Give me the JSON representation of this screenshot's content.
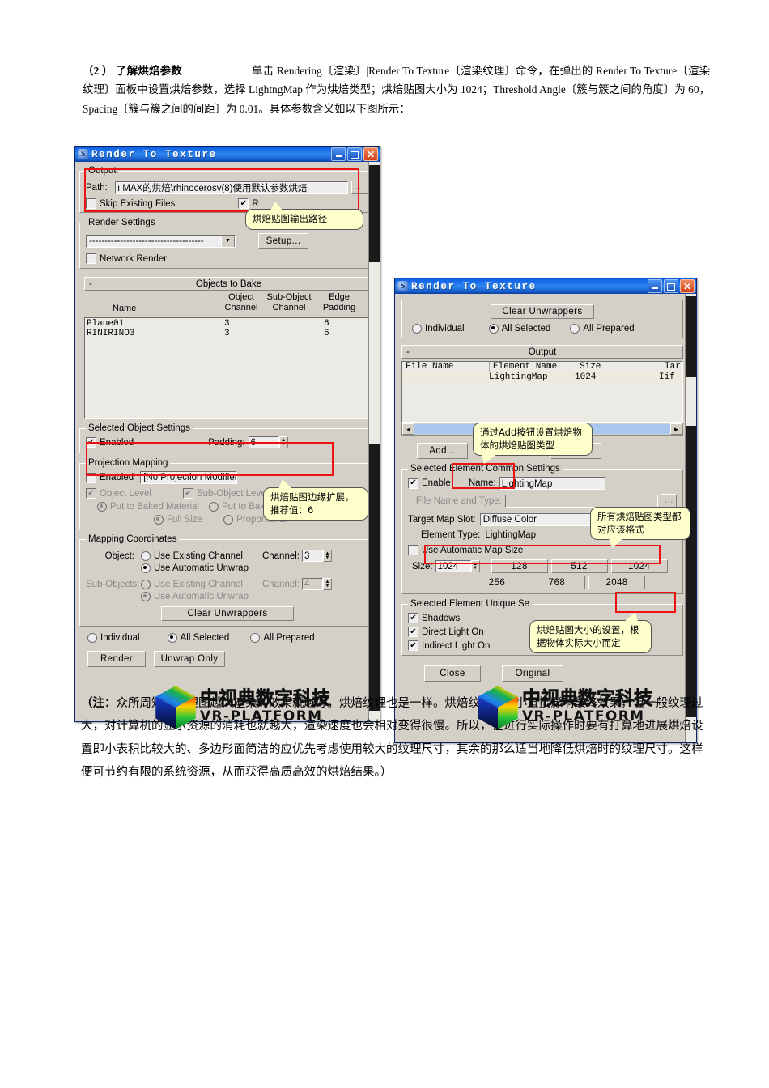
{
  "document": {
    "intro_label": "（2 ）",
    "intro_heading": "了解烘焙参数",
    "intro_body": "单击 Rendering〔渲染〕|Render To Texture〔渲染纹理〕命令，在弹出的 Render To Texture〔渲染纹理〕面板中设置烘焙参数，选择 LightngMap 作为烘焙类型；烘焙贴图大小为 1024；Threshold Angle〔簇与簇之间的角度〕为 60，Spacing〔簇与簇之间的间距〕为 0.01。具体参数含义如以下图所示：",
    "note_prefix": "（注：",
    "note_body": "众所周知，纹理图越大渲染的效果就越好，烘焙纹理也是一样。烘焙纹理的大小直接影响最终效果，但一般纹理过大，对计算机的显示资源的消耗也就越大，渲染速度也会相对变得很慢。所以，在进行实际操作时要有打算地进展烘焙设置即小表积比较大的、多边形面简洁的应优先考虑使用较大的纹理尺寸，其余的那么适当地降低烘焙时的纹理尺寸。这样便可节约有限的系统资源，从而获得高质高效的烘焙结果。）"
  },
  "window1": {
    "title": "Render To Texture",
    "icon": "max-logo-icon",
    "buttons": {
      "minimize": "–",
      "maximize": "□",
      "close": "✕"
    },
    "output": {
      "group_title": "Output",
      "path_label": "Path:",
      "path_value": "ı MAX的烘焙\\rhinocerosv(8)使用默认参数烘焙",
      "browse_label": "...",
      "skip_existing_label": "Skip Existing Files",
      "skip_existing_checked": false,
      "rendered_label": "R",
      "rendered_checked": true
    },
    "render_settings": {
      "group_title": "Render Settings",
      "preset_value": "-------------------------------------",
      "setup_label": "Setup...",
      "network_render_label": "Network Render",
      "network_render_checked": false
    },
    "objects_to_bake": {
      "rollout_title": "Objects to Bake",
      "rollout_minus": "-",
      "columns": [
        "Name",
        "Object Channel",
        "Sub-Object Channel",
        "Edge Padding"
      ],
      "rows": [
        {
          "name": "Plane01",
          "object_channel": "3",
          "sub_object_channel": "",
          "edge_padding": "6"
        },
        {
          "name": "RINIRINO3",
          "object_channel": "3",
          "sub_object_channel": "",
          "edge_padding": "6"
        }
      ]
    },
    "selected_object_settings": {
      "group_title": "Selected Object Settings",
      "enabled_label": "Enabled",
      "enabled_checked": true,
      "padding_label": "Padding:",
      "padding_value": "6"
    },
    "projection_mapping": {
      "group_title": "Projection Mapping",
      "enabled_label": "Enabled",
      "enabled_checked": false,
      "modifier_value": "[No Projection Modifier]",
      "object_level_label": "Object Level",
      "object_level_checked": true,
      "sub_object_levels_label": "Sub-Object Levels",
      "sub_object_levels_checked": true,
      "put_to_baked_material_1": "Put to Baked Material",
      "put_to_baked_material_2": "Put to Baked Material",
      "full_size_label": "Full Size",
      "proportional_label": "Proportional"
    },
    "mapping_coordinates": {
      "group_title": "Mapping Coordinates",
      "object_label": "Object:",
      "object_use_existing": "Use Existing Channel",
      "object_use_automatic": "Use Automatic Unwrap",
      "object_selected": "Use Automatic Unwrap",
      "object_channel_label": "Channel:",
      "object_channel_value": "3",
      "sub_objects_label": "Sub-Objects:",
      "sub_use_existing": "Use Existing Channel",
      "sub_use_automatic": "Use Automatic Unwrap",
      "sub_channel_label": "Channel:",
      "sub_channel_value": "4",
      "clear_unwrappers_label": "Clear Unwrappers"
    },
    "bake_scope": {
      "individual_label": "Individual",
      "all_selected_label": "All Selected",
      "all_prepared_label": "All Prepared",
      "selected": "All Selected"
    },
    "footer": {
      "render_label": "Render",
      "unwrap_only_label": "Unwrap Only"
    }
  },
  "window2": {
    "title": "Render To Texture",
    "icon": "max-logo-icon",
    "buttons": {
      "minimize": "–",
      "maximize": "□",
      "close": "✕"
    },
    "clear_unwrappers_label": "Clear Unwrappers",
    "bake_scope": {
      "individual_label": "Individual",
      "all_selected_label": "All Selected",
      "all_prepared_label": "All Prepared",
      "selected": "All Selected"
    },
    "output": {
      "rollout_title": "Output",
      "rollout_minus": "-",
      "columns": [
        "File Name",
        "Element Name",
        "Size",
        "Tar"
      ],
      "rows": [
        {
          "file_name": "",
          "element_name": "LightingMap",
          "size": "1024",
          "target": "Iif"
        }
      ],
      "add_label": "Add...",
      "delete_label": "Delete"
    },
    "common_settings": {
      "group_title": "Selected Element Common Settings",
      "enable_label": "Enable",
      "enable_checked": true,
      "name_label": "Name:",
      "name_value": "LightingMap",
      "file_name_type_label": "File Name and Type:",
      "file_name_type_value": "",
      "target_map_slot_label": "Target Map Slot:",
      "target_map_slot_value": "Diffuse Color",
      "element_type_label": "Element Type:",
      "element_type_value": "LightingMap",
      "use_automatic_map_size_label": "Use Automatic Map Size",
      "use_automatic_map_size_checked": false,
      "size_label": "Size:",
      "size_value": "1024",
      "size_presets": [
        "128",
        "512",
        "1024",
        "256",
        "768",
        "2048"
      ],
      "size_selected": "1024"
    },
    "unique_settings": {
      "group_title": "Selected Element Unique Se",
      "items": [
        {
          "label": "Shadows",
          "checked": true
        },
        {
          "label": "Direct Light On",
          "checked": true
        },
        {
          "label": "Indirect Light On",
          "checked": true
        }
      ]
    },
    "footer": {
      "close_label": "Close",
      "original_label": "Original"
    }
  },
  "callouts": [
    {
      "id": "output-path",
      "text": "烘焙贴图输出路径"
    },
    {
      "id": "padding",
      "text": "烘焙贴图边缘扩展，推荐值：6"
    },
    {
      "id": "add-button",
      "text": "通过Add按钮设置烘焙物体的烘焙贴图类型"
    },
    {
      "id": "map-format",
      "text": "所有烘焙贴图类型都对应该格式"
    },
    {
      "id": "map-size",
      "text": "烘焙贴图大小的设置，根据物体实际大小而定"
    }
  ],
  "watermarks": [
    {
      "id": "watermark-left",
      "cn": "中视典数字科技",
      "en": "VR-PLATFORM",
      "logo": "vr-platform-cube-logo"
    },
    {
      "id": "watermark-right",
      "cn": "中视典数字科技",
      "en": "VR-PLATFORM",
      "logo": "vr-platform-cube-logo"
    }
  ],
  "colors": {
    "title_bar_blue": "#1668e8",
    "dialog_face": "#d4d0c8",
    "highlight_red": "#ee1111",
    "callout_yellow": "#ffffcc",
    "field_white": "#eeeeee"
  }
}
